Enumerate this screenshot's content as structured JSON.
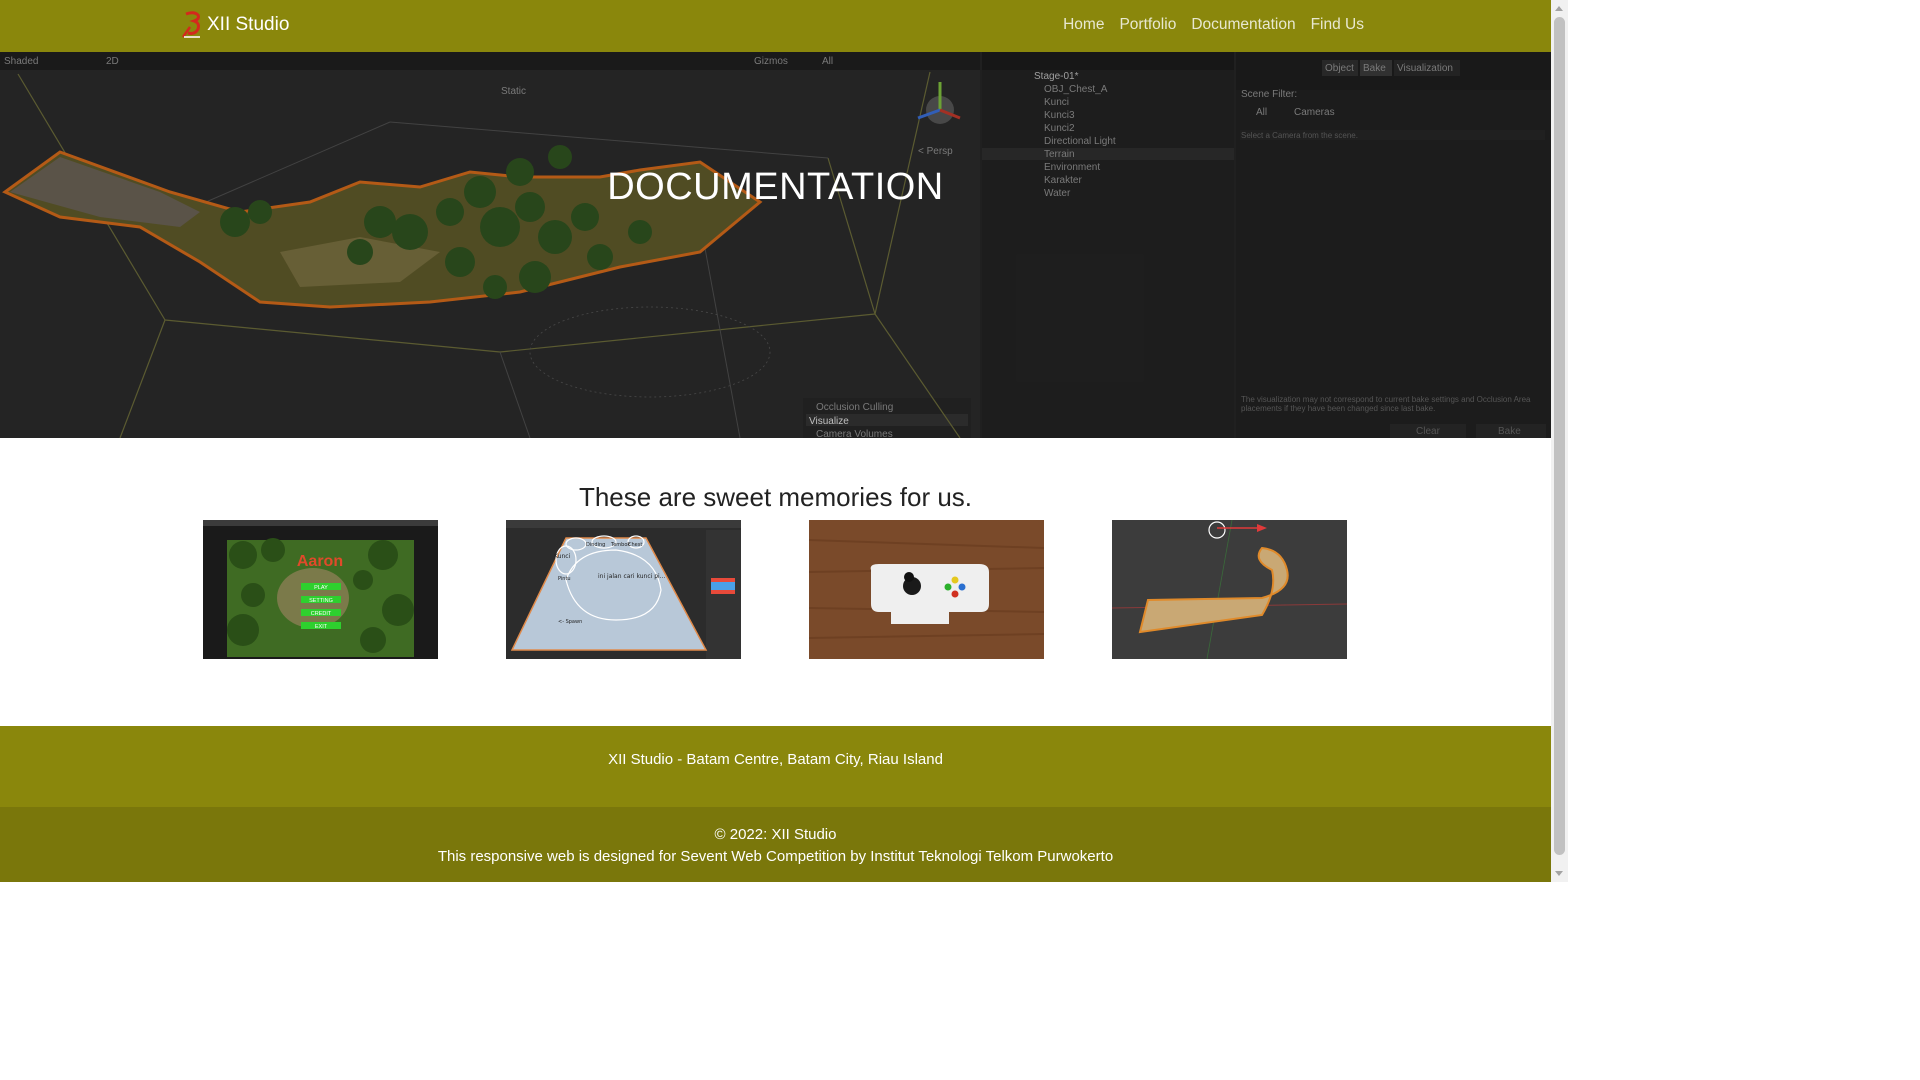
{
  "navbar": {
    "brand": "XII Studio",
    "links": [
      "Home",
      "Portfolio",
      "Documentation",
      "Find Us"
    ]
  },
  "hero": {
    "title": "DOCUMENTATION",
    "editor": {
      "toolbar_shading": "Shaded",
      "toolbar_2d": "2D",
      "toolbar_gizmos": "Gizmos",
      "toolbar_all": "All",
      "static_label": "Static",
      "persp_label": "< Persp",
      "hierarchy": [
        "Stage-01*",
        "OBJ_Chest_A",
        "Kunci",
        "Kunci3",
        "Kunci2",
        "Directional Light",
        "Terrain",
        "Environment",
        "Karakter",
        "Water"
      ],
      "tabs": [
        "Object",
        "Bake",
        "Visualization"
      ],
      "scene_filter": "Scene Filter:",
      "filter_all": "All",
      "filter_cameras": "Cameras",
      "select_camera": "Select a Camera from the scene.",
      "occlusion_culling": "Occlusion Culling",
      "visualize": "Visualize",
      "camera_volumes": "Camera Volumes",
      "note": "The visualization may not correspond to current bake settings and Occlusion Area placements if they have been changed since last bake.",
      "clear": "Clear",
      "bake": "Bake"
    }
  },
  "memories": {
    "title": "These are sweet memories for us.",
    "game_menu": {
      "title": "Aaron",
      "buttons": [
        "PLAY",
        "SETTING",
        "CREDIT",
        "EXIT"
      ]
    },
    "sketch_labels": [
      "Dinding",
      "Tembok",
      "Chest",
      "Kunci",
      "Pintu",
      "ini jalan cari kunci pi...",
      "<- Spawn"
    ]
  },
  "footer": {
    "location": "XII Studio - Batam Centre, Batam City, Riau Island",
    "copyright": "© 2022: XII Studio",
    "credit": "This responsive web is designed for Sevent Web Competition by Institut Teknologi Telkom Purwokerto"
  },
  "colors": {
    "navbar": "#8a870c",
    "footer_top": "#8a870c",
    "footer_bottom": "#7a770b"
  }
}
